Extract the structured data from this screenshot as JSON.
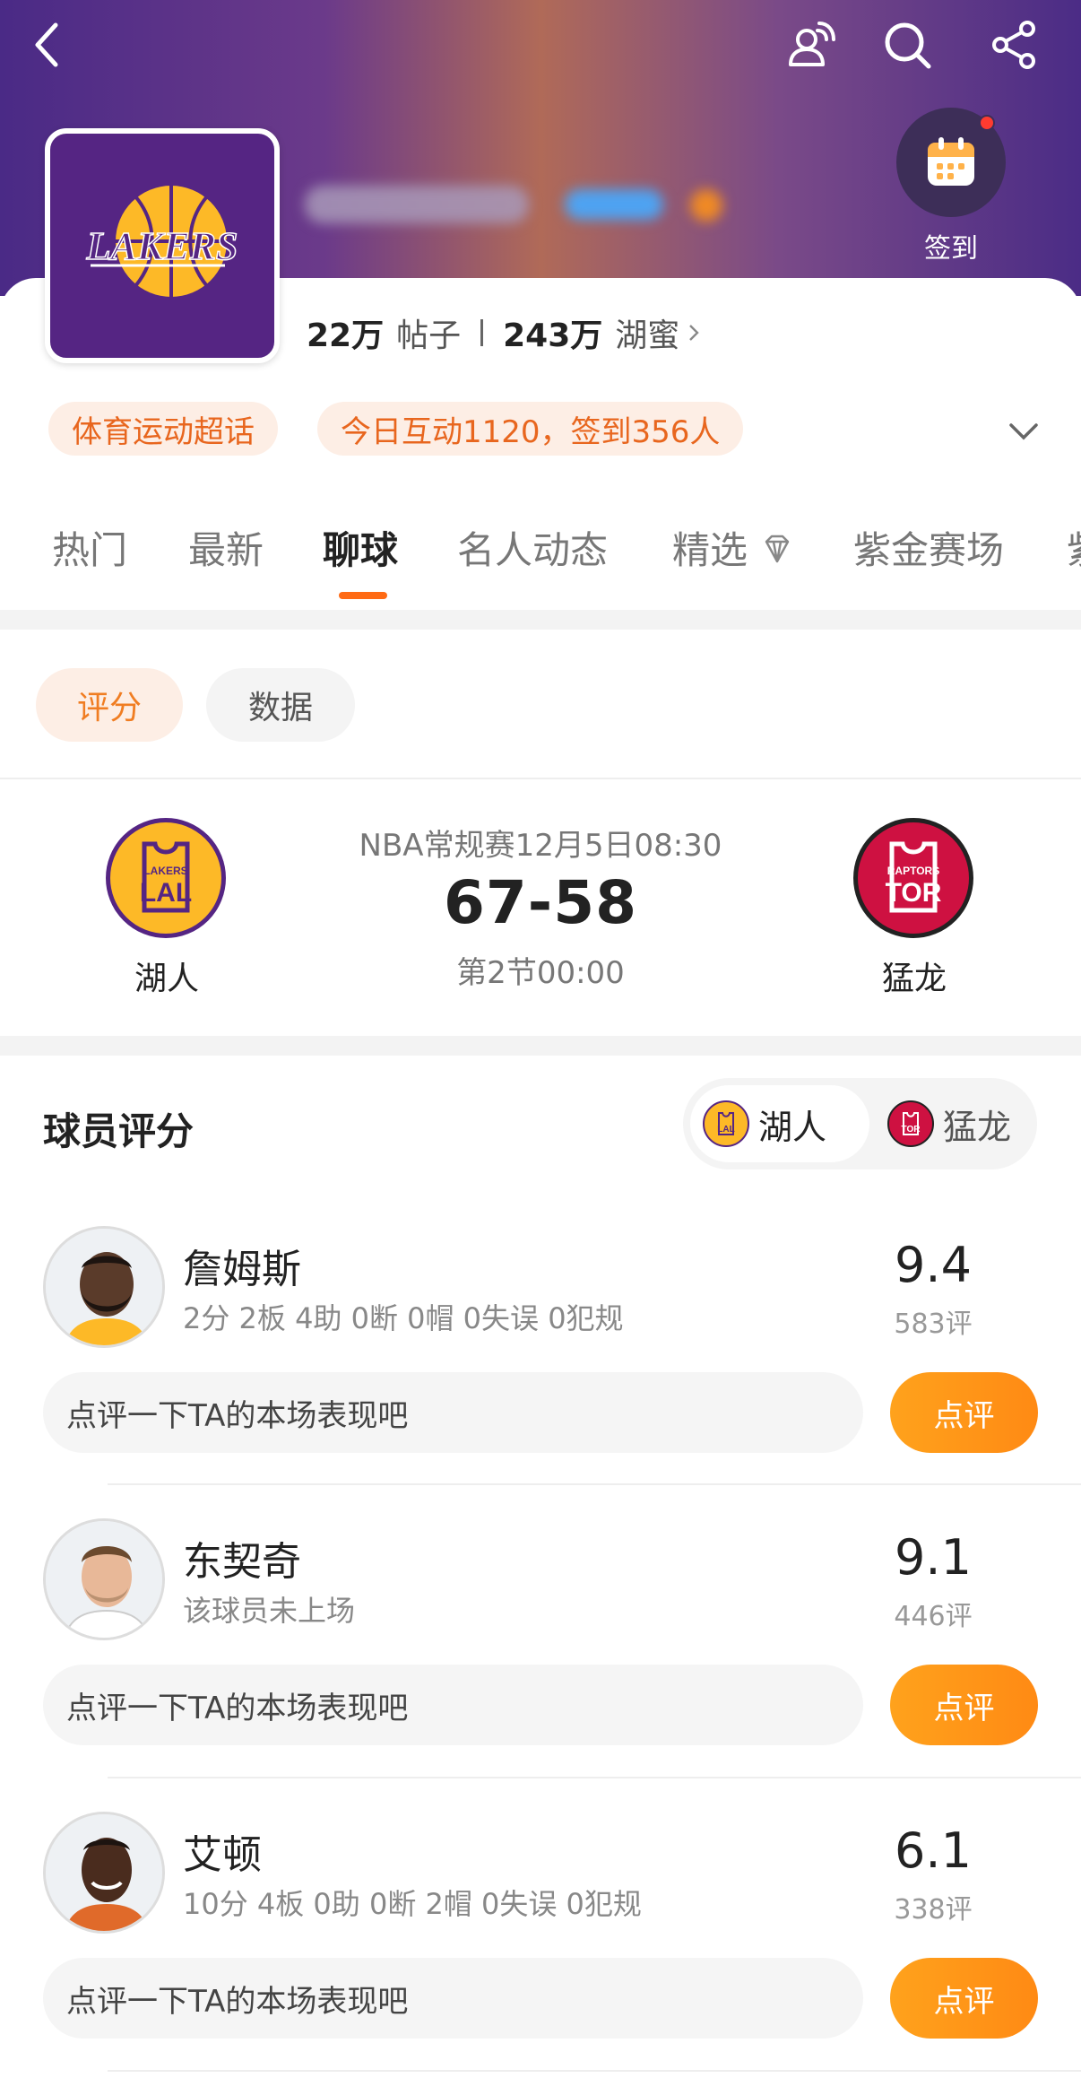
{
  "header": {
    "signin_label": "签到",
    "stats": {
      "posts_num": "22万",
      "posts_unit": "帖子",
      "fans_num": "243万",
      "fans_unit": "湖蜜"
    },
    "tags": [
      "体育运动超话",
      "今日互动1120，签到356人"
    ]
  },
  "tabs": [
    {
      "label": "热门"
    },
    {
      "label": "最新"
    },
    {
      "label": "聊球",
      "active": true
    },
    {
      "label": "名人动态"
    },
    {
      "label": "精选"
    },
    {
      "label": "紫金赛场"
    },
    {
      "label": "紫"
    }
  ],
  "subtabs": {
    "rating": "评分",
    "data": "数据"
  },
  "match": {
    "info": "NBA常规赛12月5日08:30",
    "score": "67-58",
    "period": "第2节00:00",
    "home": {
      "name": "湖人",
      "abbr": "LAL",
      "small": "LAKERS",
      "color": "#552583",
      "accent": "#fdb927"
    },
    "away": {
      "name": "猛龙",
      "abbr": "TOR",
      "small": "RAPTORS",
      "color": "#ce1141",
      "accent": "#ffffff"
    }
  },
  "ratings": {
    "title": "球员评分",
    "switch_home": "湖人",
    "switch_away": "猛龙",
    "comment_placeholder": "点评一下TA的本场表现吧",
    "comment_button": "点评",
    "players": [
      {
        "name": "詹姆斯",
        "stats": "2分 2板 4助 0断 0帽 0失误 0犯规",
        "rating": "9.4",
        "votes": "583评"
      },
      {
        "name": "东契奇",
        "stats": "该球员未上场",
        "rating": "9.1",
        "votes": "446评"
      },
      {
        "name": "艾顿",
        "stats": "10分 4板 0助 0断 2帽 0失误 0犯规",
        "rating": "6.1",
        "votes": "338评"
      }
    ]
  },
  "colors": {
    "accent": "#ff6a14",
    "brand_purple": "#552583",
    "raptors_red": "#ce1141"
  }
}
